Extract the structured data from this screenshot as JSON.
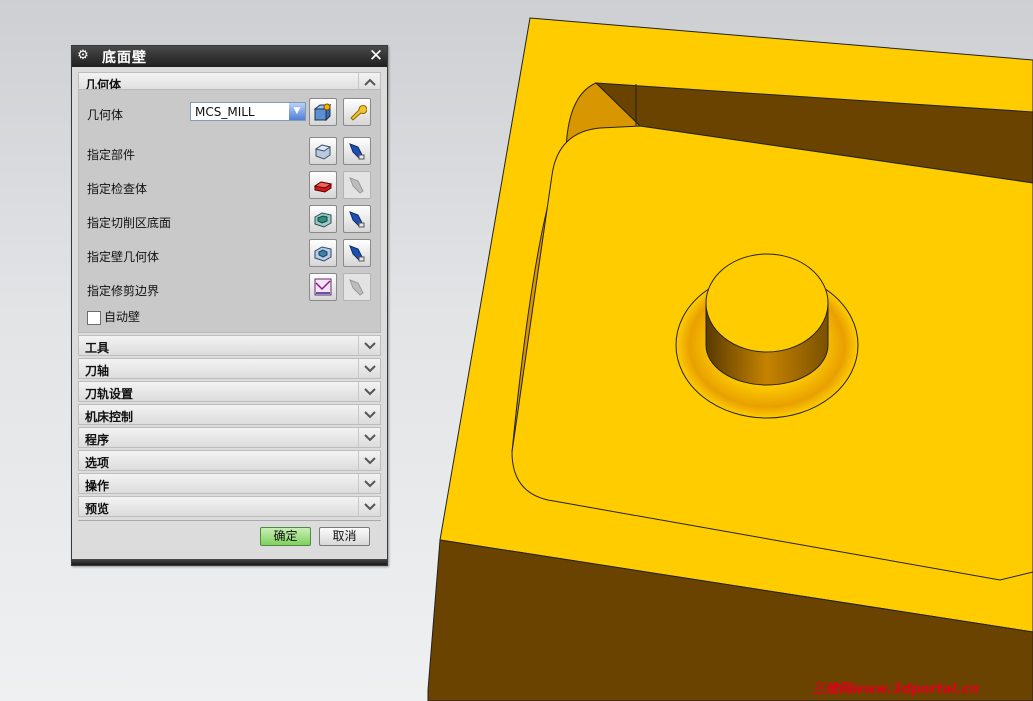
{
  "dialog": {
    "title": "底面壁",
    "geometry_section": {
      "label": "几何体",
      "geometry_label": "几何体",
      "geometry_value": "MCS_MILL",
      "rows": [
        {
          "label": "指定部件"
        },
        {
          "label": "指定检查体"
        },
        {
          "label": "指定切削区底面"
        },
        {
          "label": "指定壁几何体"
        },
        {
          "label": "指定修剪边界"
        }
      ],
      "auto_wall_label": "自动壁"
    },
    "collapsed_sections": [
      "工具",
      "刀轴",
      "刀轨设置",
      "机床控制",
      "程序",
      "选项",
      "操作",
      "预览"
    ],
    "ok_label": "确定",
    "cancel_label": "取消"
  },
  "watermark": "三维网www.3dportal.cn",
  "colors": {
    "part_top": "#ffcc00",
    "part_side": "#6b4300",
    "ok_button": "#7fcf5f"
  }
}
